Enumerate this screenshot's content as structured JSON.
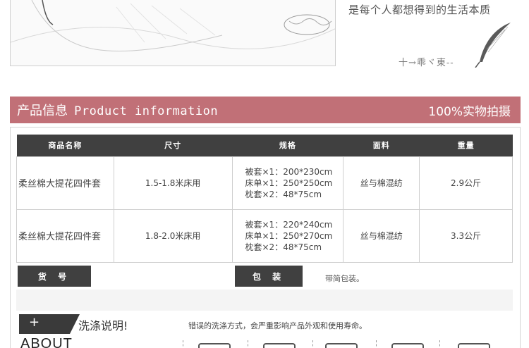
{
  "banner": {
    "tagline": "是每个人都想得到的生活本质",
    "signature": "十→乖ヾ東--"
  },
  "info_bar": {
    "title_cn": "产品信息",
    "title_en": "Product information",
    "right_label": "100%实物拍摄",
    "color": "#c17077"
  },
  "table": {
    "headers": [
      "商品名称",
      "尺寸",
      "规格",
      "面料",
      "重量"
    ],
    "rows": [
      {
        "name": "柔丝棉大提花四件套",
        "size": "1.5-1.8米床用",
        "spec": [
          "被套×1：200*230cm",
          "床单×1：250*250cm",
          "枕套×2：48*75cm"
        ],
        "fabric": "丝与棉混纺",
        "weight": "2.9公斤"
      },
      {
        "name": "柔丝棉大提花四件套",
        "size": "1.8-2.0米床用",
        "spec": [
          "被套×1：220*240cm",
          "床单×1：250*270cm",
          "枕套×2：48*75cm"
        ],
        "fabric": "丝与棉混纺",
        "weight": "3.3公斤"
      }
    ]
  },
  "meta_row": {
    "goods_no_label": "货 号",
    "goods_no_value": "",
    "packaging_label": "包 装",
    "packaging_value": "带简包装。"
  },
  "washing": {
    "plus": "+",
    "heading": "洗涤说明!",
    "warning": "错误的洗涤方式，会严重影响产品外观和使用寿命。",
    "about": "ABOUT"
  },
  "icons": [
    "feather-icon",
    "plus-icon",
    "wash-basin-icon"
  ]
}
